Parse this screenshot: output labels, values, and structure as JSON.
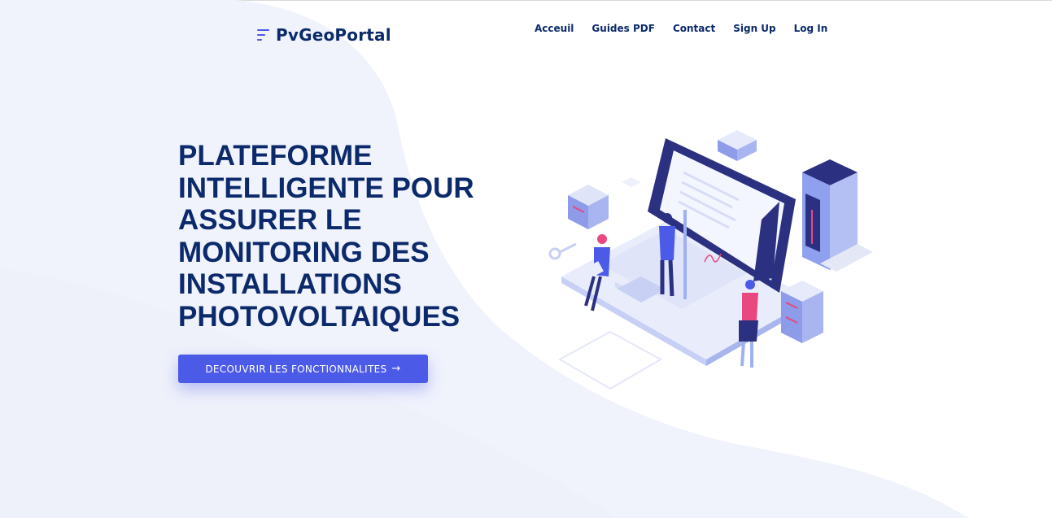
{
  "brand": {
    "name": "PvGeoPortal",
    "logo_icon": "stacked-lines-logo-icon",
    "color": "#4c5ae8"
  },
  "nav": {
    "links": [
      {
        "label": "Acceuil"
      },
      {
        "label": "Guides PDF"
      },
      {
        "label": "Contact"
      },
      {
        "label": "Sign Up"
      },
      {
        "label": "Log In"
      }
    ]
  },
  "hero": {
    "title": "PLATEFORME INTELLIGENTE POUR ASSURER LE MONITORING DES INSTALLATIONS PHOTOVOLTAIQUES",
    "cta_label": "DECOUVRIR LES FONCTIONNALITES",
    "cta_icon": "arrow-right-icon",
    "illustration": "isometric-laptop-team-illustration"
  },
  "colors": {
    "primary": "#4c5ae8",
    "heading": "#0c2a6b",
    "background_wave": "#eef1fb"
  }
}
